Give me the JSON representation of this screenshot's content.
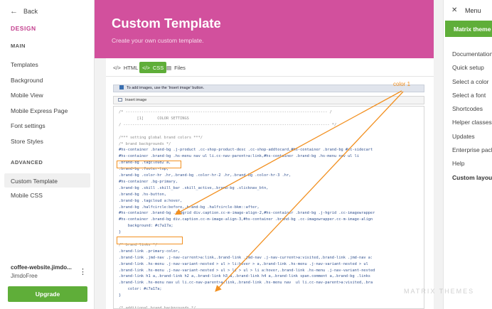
{
  "sidebar": {
    "back_label": "Back",
    "section_title": "DESIGN",
    "main_heading": "MAIN",
    "main_items": [
      "Templates",
      "Background",
      "Mobile View",
      "Mobile Express Page",
      "Font settings",
      "Store Styles"
    ],
    "advanced_heading": "ADVANCED",
    "advanced_items": [
      "Custom Template",
      "Mobile CSS"
    ],
    "site_name": "coffee-website.jimdo...",
    "site_plan": "JimdoFree",
    "site_menu_icon": "⋮",
    "upgrade_label": "Upgrade"
  },
  "header": {
    "title": "Custom Template",
    "subtitle": "Create your own custom template."
  },
  "tabs": [
    {
      "icon": "</>",
      "label": "HTML"
    },
    {
      "icon": "</>",
      "label": "CSS"
    },
    {
      "icon": "▤",
      "label": "Files"
    }
  ],
  "info_bar_text": "To add images, use the 'Insert image' button.",
  "insert_image_label": "Insert image",
  "code_lines": [
    {
      "text": "/* ----------------------------------------------------------------------------------------- /",
      "cls": "cmt"
    },
    {
      "text": "        [1]      COLOR SETTINGS",
      "cls": "cmt"
    },
    {
      "text": "/ ------------------------------------------------------------------------------------------- */",
      "cls": "cmt"
    },
    {
      "text": "",
      "cls": ""
    },
    {
      "text": "/*** setting global brand colors ***/",
      "cls": "cmt"
    },
    {
      "text": "/* brand backgrounds */",
      "cls": "cmt"
    },
    {
      "text": "#hs-container .brand-bg .j-product .cc-shop-product-desc .cc-shop-addtocard,#hs-container .brand-bg #cc-sidecart",
      "cls": ""
    },
    {
      "text": "#hs-container .brand-bg .hs-menu nav ul li.cc-nav-parent>a:link,#hs-container .brand-bg .hs-menu nav ul li",
      "cls": ""
    },
    {
      "text": ".brand-bg .tagcloud2 a,",
      "cls": ""
    },
    {
      "text": ".brand-bg .footer-top,",
      "cls": ""
    },
    {
      "text": ".brand-bg .color-hr .hr,.brand-bg .color-hr-2 .hr,.brand-bg .color-hr-3 .hr,",
      "cls": ""
    },
    {
      "text": "#hs-container .bg-primary,",
      "cls": ""
    },
    {
      "text": ".brand-bg .skill .skill_bar .skill_active,.brand-bg .slicknav_btn,",
      "cls": ""
    },
    {
      "text": ".brand-bg .hs-button,",
      "cls": ""
    },
    {
      "text": ".brand-bg .tagcloud a:hover,",
      "cls": ""
    },
    {
      "text": ".brand-bg .halfcircle:before,.brand-bg .halfcircle-bkm::after,",
      "cls": ""
    },
    {
      "text": "#hs-container .brand-bg .j-hgrid div.caption.cc-m-image-align-2,#hs-container .brand-bg .j-hgrid .cc-imagewrapper",
      "cls": ""
    },
    {
      "text": "#hs-container .brand-bg div.caption.cc-m-image-align-3,#hs-container .brand-bg .cc-imagewrapper.cc-m-image-align",
      "cls": ""
    },
    {
      "text": "    background: #c7a17a;",
      "cls": ""
    },
    {
      "text": "}",
      "cls": ""
    },
    {
      "text": "",
      "cls": ""
    },
    {
      "text": "/* brand links */",
      "cls": "cmt"
    },
    {
      "text": ".brand-link .primary-color,",
      "cls": ""
    },
    {
      "text": ".brand-link .jmd-nav .j-nav-current>a:link,.brand-link .jmd-nav .j-nav-current>a:visited,.brand-link .jmd-nav a:",
      "cls": ""
    },
    {
      "text": ".brand-link .hs-menu .j-nav-variant-nested > ul > li:hover > a,.brand-link .hs-menu .j-nav-variant-nested > ul",
      "cls": ""
    },
    {
      "text": ".brand-link .hs-menu .j-nav-variant-nested > ul > li > ul > li a:hover,.brand-link .hs-menu .j-nav-variant-nested",
      "cls": ""
    },
    {
      "text": ".brand-link h1 a,.brand-link h2 a,.brand-link h3 a,.brand-link h4 a,.brand-link span.comment a,.brand-bg .links",
      "cls": ""
    },
    {
      "text": ".brand-link .hs-menu nav ul li.cc-nav-parent>a:link,.brand-link .hs-menu nav  ul li.cc-nav-parent>a:visited,.bra",
      "cls": ""
    },
    {
      "text": "    color: #c7a17a;",
      "cls": ""
    },
    {
      "text": "}",
      "cls": ""
    },
    {
      "text": "",
      "cls": ""
    },
    {
      "text": "/* additional brand backgrounds */",
      "cls": "cmt"
    }
  ],
  "annotation_label": "color 1",
  "right_menu": {
    "close_icon": "✕",
    "title": "Menu",
    "active_item": "Matrix theme",
    "items": [
      "Documentation",
      "Quick setup",
      "Select a color",
      "Select a font",
      "Shortcodes",
      "Helper classes",
      "Updates",
      "Enterprise pack",
      "Help",
      "Custom layout"
    ]
  },
  "watermark": "MATRIX THEMES",
  "colors": {
    "header_pink": "#d2509d",
    "accent_green": "#5fae39",
    "annotation_orange": "#f29020",
    "brand_color": "#c7a17a"
  }
}
